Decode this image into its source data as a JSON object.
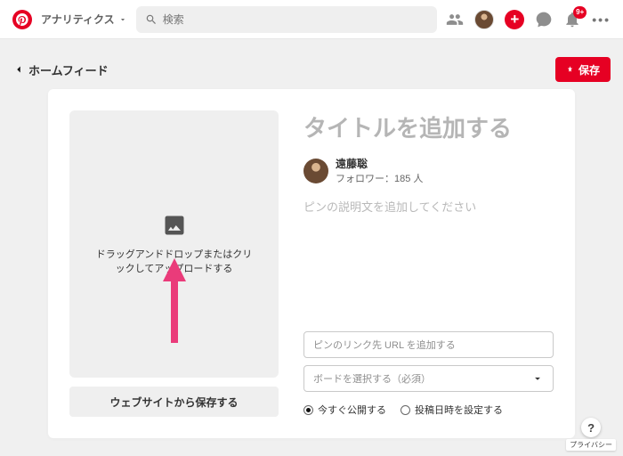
{
  "header": {
    "analytics_label": "アナリティクス",
    "search_placeholder": "検索",
    "notification_badge": "9+"
  },
  "crumb": {
    "back_label": "ホームフィード",
    "save_label": "保存"
  },
  "uploader": {
    "dropzone_text": "ドラッグアンドドロップまたはクリックしてアップロードする",
    "website_button": "ウェブサイトから保存する"
  },
  "form": {
    "title_placeholder": "タイトルを追加する",
    "author_name": "遠藤聡",
    "followers": "フォロワー：185 人",
    "description_placeholder": "ピンの説明文を追加してください",
    "url_placeholder": "ピンのリンク先 URL を追加する",
    "board_placeholder": "ボードを選択する（必須）",
    "radio_now": "今すぐ公開する",
    "radio_schedule": "投稿日時を設定する"
  },
  "footer": {
    "privacy_label": "プライバシー"
  }
}
